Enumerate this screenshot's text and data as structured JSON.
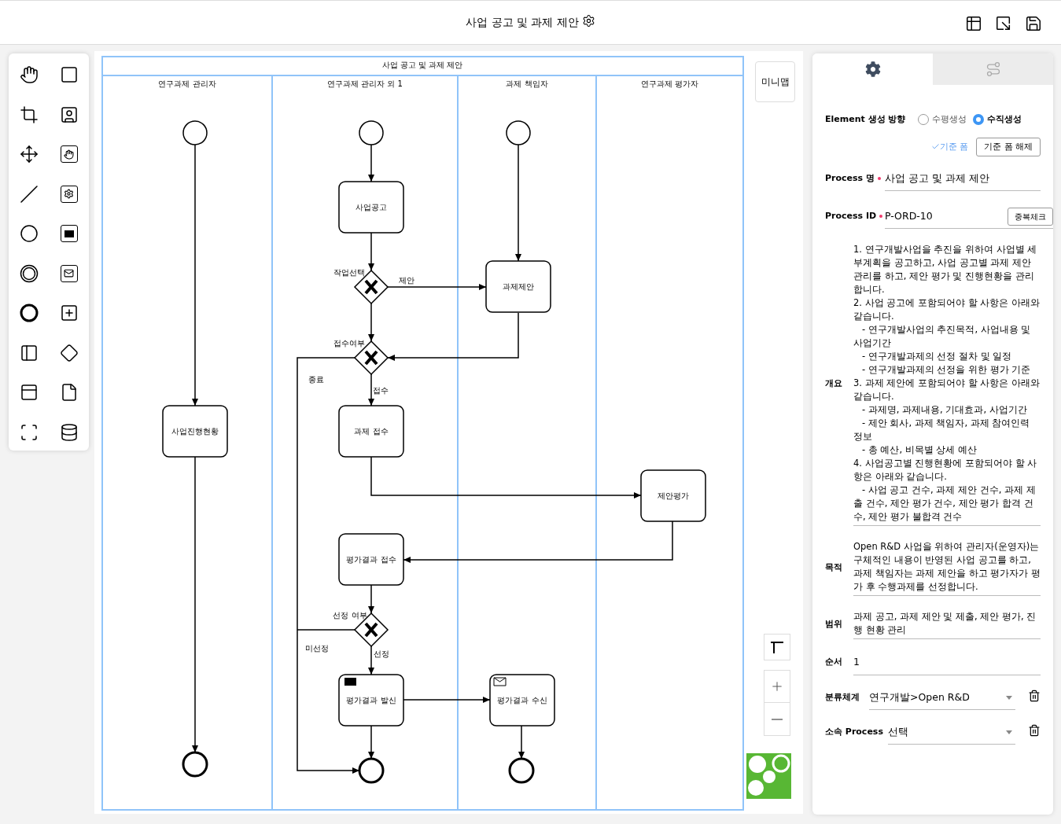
{
  "header": {
    "title": "사업 공고 및 과제 제안"
  },
  "diagram": {
    "pool_title": "사업 공고 및 과제 제안",
    "lanes": [
      "연구과제 관리자",
      "연구과제 관리자 외 1",
      "과제 책임자",
      "연구과제 평가자"
    ],
    "tasks": [
      {
        "label": "사업진행현황",
        "kind": "task"
      },
      {
        "label": "사업공고",
        "kind": "task"
      },
      {
        "label": "과제제안",
        "kind": "task"
      },
      {
        "label": "과제 접수",
        "kind": "task"
      },
      {
        "label": "제안평가",
        "kind": "task"
      },
      {
        "label": "평가결과 접수",
        "kind": "task"
      },
      {
        "label": "평가결과 발신",
        "kind": "send"
      },
      {
        "label": "평가결과 수신",
        "kind": "receive"
      }
    ],
    "gateways": [
      "작업선택",
      "접수여부",
      "선정 여부"
    ],
    "flow_labels": [
      "제안",
      "종료",
      "접수",
      "미선정",
      "선정"
    ]
  },
  "canvas": {
    "minimap_button": "미니맵"
  },
  "panel": {
    "tabs": [
      {
        "kind": "settings",
        "selected": true
      },
      {
        "kind": "flow",
        "selected": false
      }
    ],
    "direction": {
      "label": "Element 생성 방향",
      "options": [
        {
          "label": "수평생성",
          "selected": false
        },
        {
          "label": "수직생성",
          "selected": true
        }
      ]
    },
    "base_form": {
      "status": "기준 폼",
      "button": "기준 폼 해제"
    },
    "fields": [
      {
        "kind": "text",
        "label": "Process 명",
        "required": true,
        "value": "사업 공고 및 과제 제안"
      },
      {
        "kind": "text",
        "label": "Process ID",
        "required": true,
        "value": "P-ORD-10",
        "button": "중복체크"
      },
      {
        "kind": "textarea",
        "label": "개요",
        "required": false,
        "value": "1. 연구개발사업을 추진을 위하여 사업별 세부계획을 공고하고, 사업 공고별 과제 제안 관리를 하고, 제안 평가 및 진행현황을 관리합니다.\n2. 사업 공고에 포함되어야 할 사항은 아래와 같습니다.\n   - 연구개발사업의 추진목적, 사업내용 및 사업기간\n   - 연구개발과제의 선정 절차 및 일정\n   - 연구개발과제의 선정을 위한 평가 기준\n3. 과제 제안에 포함되어야 할 사항은 아래와 같습니다.\n   - 과제명, 과제내용, 기대효과, 사업기간\n   - 제안 회사, 과제 책임자, 과제 참여인력 정보\n   - 총 예산, 비목별 상세 예산\n4. 사업공고별 진행현황에 포함되어야 할 사항은 아래와 같습니다.\n   - 사업 공고 건수, 과제 제안 건수, 과제 제출 건수, 제안 평가 건수, 제안 평가 합격 건수, 제안 평가 불합격 건수"
      },
      {
        "kind": "textarea",
        "label": "목적",
        "required": false,
        "value": "Open R&D 사업을 위하여 관리자(운영자)는 구체적인 내용이 반영된 사업 공고를 하고, 과제 책임자는 과제 제안을 하고 평가자가 평가 후 수행과제를 선정합니다."
      },
      {
        "kind": "textarea",
        "label": "범위",
        "required": false,
        "value": "과제 공고, 과제 제안 및 제출, 제안 평가, 진행 현황 관리"
      },
      {
        "kind": "line",
        "label": "순서",
        "required": false,
        "value": "1"
      },
      {
        "kind": "select",
        "label": "분류체계",
        "required": false,
        "value": "연구개발>Open R&D"
      },
      {
        "kind": "select",
        "label": "소속 Process",
        "required": false,
        "value": "선택"
      }
    ]
  }
}
